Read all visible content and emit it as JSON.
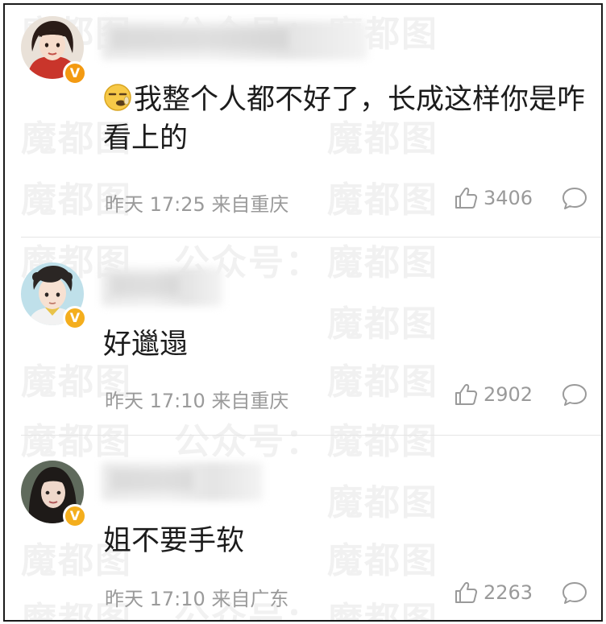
{
  "watermark": {
    "text_a": "魔都图",
    "text_b": "公众号："
  },
  "colors": {
    "verified_badge": "#f4ae1d",
    "meta_text": "#9a9a9a",
    "body_text": "#1c1c1c"
  },
  "comments": [
    {
      "avatar": "avatar-woman-red-top",
      "badge": "V",
      "emoji": "yawning-face-emoji",
      "text": "我整个人都不好了，长成这样你是咋看上的",
      "time": "昨天 17:25",
      "location": "来自重庆",
      "likes": "3406"
    },
    {
      "avatar": "avatar-young-man-curly-hair",
      "badge": "V",
      "text": "好邋遢",
      "time": "昨天 17:10",
      "location": "来自重庆",
      "likes": "2902"
    },
    {
      "avatar": "avatar-woman-dark-hair",
      "badge": "V",
      "text": "姐不要手软",
      "time": "昨天 17:10",
      "location": "来自广东",
      "likes": "2263"
    }
  ]
}
